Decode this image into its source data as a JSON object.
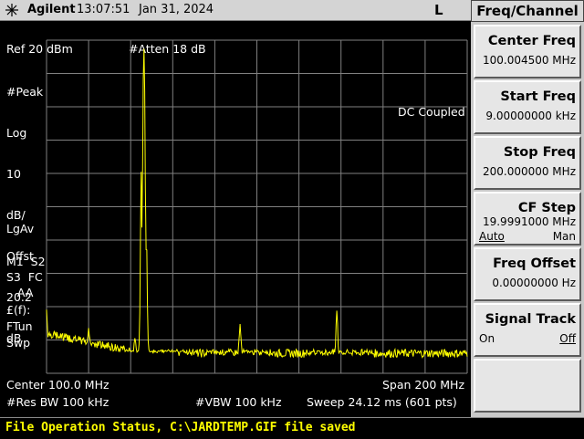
{
  "header": {
    "brand": "Agilent",
    "time": "13:07:51",
    "date": "Jan 31, 2024",
    "mode_indicator": "L"
  },
  "display": {
    "ref_level": "Ref 20 dBm",
    "atten": "#Atten 18 dB",
    "left_annotations": [
      "#Peak",
      "Log",
      "10",
      "dB/",
      "Offst",
      "20.2",
      "dB"
    ],
    "lgav": "LgAv",
    "markers_row1": "M1  S2",
    "markers_row2": "S3  FC",
    "markers_row3": "   AA",
    "ff_label": "£(f):",
    "ftun": "FTun",
    "swp": "Swp",
    "coupling": "DC Coupled",
    "center": "Center 100.0 MHz",
    "span": "Span 200 MHz",
    "res_bw": "#Res BW 100 kHz",
    "vbw": "#VBW 100 kHz",
    "sweep": "Sweep 24.12 ms (601 pts)",
    "trace_color": "#ffff00",
    "grid_color": "#808080"
  },
  "chart_data": {
    "type": "line",
    "x_unit": "MHz",
    "y_unit": "dBm",
    "xlim": [
      0,
      200
    ],
    "ylim": [
      -80,
      20
    ],
    "grid": true,
    "peaks": [
      {
        "x": 0.0,
        "y": -61
      },
      {
        "x": 4.0,
        "y": -70
      },
      {
        "x": 20.0,
        "y": -66
      },
      {
        "x": 40.0,
        "y": -73
      },
      {
        "x": 42.0,
        "y": -69
      },
      {
        "x": 45.0,
        "y": -20
      },
      {
        "x": 46.3,
        "y": 18
      },
      {
        "x": 47.5,
        "y": -40
      },
      {
        "x": 92.0,
        "y": -65
      },
      {
        "x": 138.0,
        "y": -61
      }
    ],
    "noise_floor": -74
  },
  "status": {
    "message": "File Operation Status, C:\\JARDTEMP.GIF file saved"
  },
  "softkeys": {
    "title": "Freq/Channel",
    "keys": [
      {
        "label": "Center Freq",
        "value": "100.004500 MHz"
      },
      {
        "label": "Start Freq",
        "value": "9.00000000 kHz"
      },
      {
        "label": "Stop Freq",
        "value": "200.000000 MHz"
      },
      {
        "label": "CF Step",
        "value": "19.9991000 MHz",
        "opt_left": "Auto",
        "opt_right": "Man"
      },
      {
        "label": "Freq Offset",
        "value": "0.00000000  Hz"
      },
      {
        "label": "Signal Track",
        "opt_left": "On",
        "opt_right": "Off"
      },
      {
        "label": ""
      }
    ]
  }
}
